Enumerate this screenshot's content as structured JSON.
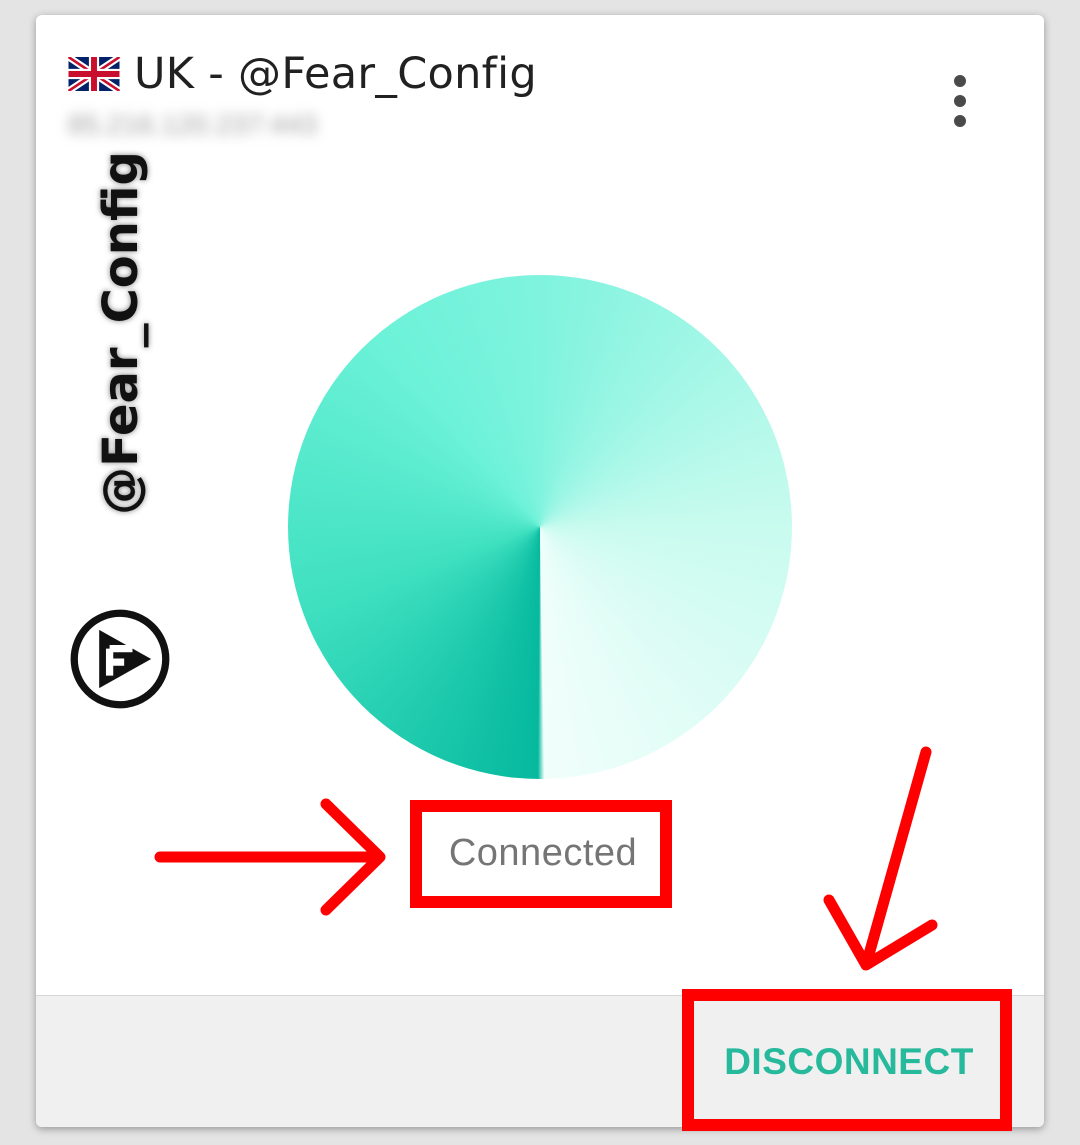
{
  "server": {
    "flag_icon": "uk-flag-icon",
    "name": "UK - @Fear_Config",
    "address": "85.216.120.237:443"
  },
  "menu": {
    "icon": "more-vert-icon"
  },
  "watermark": {
    "text": "@Fear_Config",
    "logo": "fear-config-logo"
  },
  "status": {
    "label": "Connected",
    "accent_color": "#26b99b"
  },
  "actions": {
    "disconnect_label": "DISCONNECT"
  },
  "annotations": {
    "color": "#ff0000"
  }
}
